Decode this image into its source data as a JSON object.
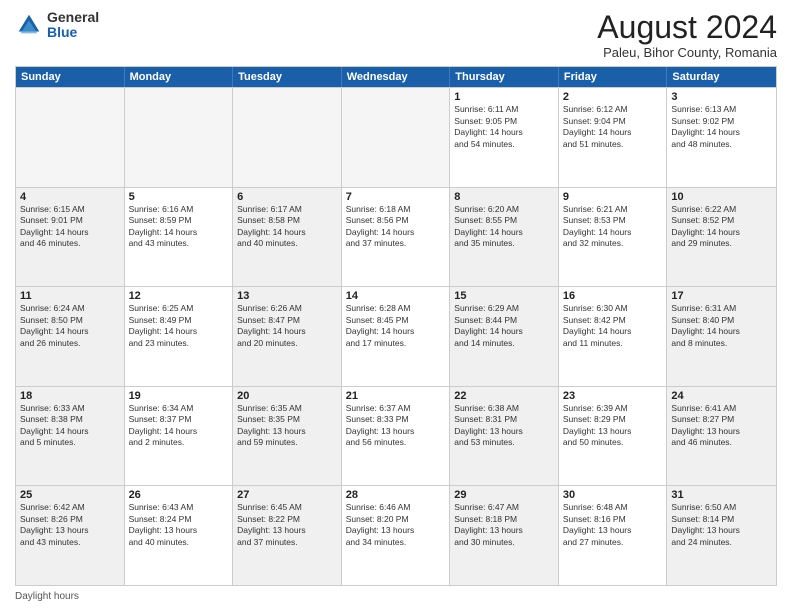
{
  "logo": {
    "general": "General",
    "blue": "Blue"
  },
  "title": "August 2024",
  "location": "Paleu, Bihor County, Romania",
  "days_of_week": [
    "Sunday",
    "Monday",
    "Tuesday",
    "Wednesday",
    "Thursday",
    "Friday",
    "Saturday"
  ],
  "footer_note": "Daylight hours",
  "weeks": [
    [
      {
        "day": "",
        "info": "",
        "empty": true
      },
      {
        "day": "",
        "info": "",
        "empty": true
      },
      {
        "day": "",
        "info": "",
        "empty": true
      },
      {
        "day": "",
        "info": "",
        "empty": true
      },
      {
        "day": "1",
        "info": "Sunrise: 6:11 AM\nSunset: 9:05 PM\nDaylight: 14 hours\nand 54 minutes."
      },
      {
        "day": "2",
        "info": "Sunrise: 6:12 AM\nSunset: 9:04 PM\nDaylight: 14 hours\nand 51 minutes."
      },
      {
        "day": "3",
        "info": "Sunrise: 6:13 AM\nSunset: 9:02 PM\nDaylight: 14 hours\nand 48 minutes."
      }
    ],
    [
      {
        "day": "4",
        "info": "Sunrise: 6:15 AM\nSunset: 9:01 PM\nDaylight: 14 hours\nand 46 minutes.",
        "shaded": true
      },
      {
        "day": "5",
        "info": "Sunrise: 6:16 AM\nSunset: 8:59 PM\nDaylight: 14 hours\nand 43 minutes."
      },
      {
        "day": "6",
        "info": "Sunrise: 6:17 AM\nSunset: 8:58 PM\nDaylight: 14 hours\nand 40 minutes.",
        "shaded": true
      },
      {
        "day": "7",
        "info": "Sunrise: 6:18 AM\nSunset: 8:56 PM\nDaylight: 14 hours\nand 37 minutes."
      },
      {
        "day": "8",
        "info": "Sunrise: 6:20 AM\nSunset: 8:55 PM\nDaylight: 14 hours\nand 35 minutes.",
        "shaded": true
      },
      {
        "day": "9",
        "info": "Sunrise: 6:21 AM\nSunset: 8:53 PM\nDaylight: 14 hours\nand 32 minutes."
      },
      {
        "day": "10",
        "info": "Sunrise: 6:22 AM\nSunset: 8:52 PM\nDaylight: 14 hours\nand 29 minutes.",
        "shaded": true
      }
    ],
    [
      {
        "day": "11",
        "info": "Sunrise: 6:24 AM\nSunset: 8:50 PM\nDaylight: 14 hours\nand 26 minutes.",
        "shaded": true
      },
      {
        "day": "12",
        "info": "Sunrise: 6:25 AM\nSunset: 8:49 PM\nDaylight: 14 hours\nand 23 minutes."
      },
      {
        "day": "13",
        "info": "Sunrise: 6:26 AM\nSunset: 8:47 PM\nDaylight: 14 hours\nand 20 minutes.",
        "shaded": true
      },
      {
        "day": "14",
        "info": "Sunrise: 6:28 AM\nSunset: 8:45 PM\nDaylight: 14 hours\nand 17 minutes."
      },
      {
        "day": "15",
        "info": "Sunrise: 6:29 AM\nSunset: 8:44 PM\nDaylight: 14 hours\nand 14 minutes.",
        "shaded": true
      },
      {
        "day": "16",
        "info": "Sunrise: 6:30 AM\nSunset: 8:42 PM\nDaylight: 14 hours\nand 11 minutes."
      },
      {
        "day": "17",
        "info": "Sunrise: 6:31 AM\nSunset: 8:40 PM\nDaylight: 14 hours\nand 8 minutes.",
        "shaded": true
      }
    ],
    [
      {
        "day": "18",
        "info": "Sunrise: 6:33 AM\nSunset: 8:38 PM\nDaylight: 14 hours\nand 5 minutes.",
        "shaded": true
      },
      {
        "day": "19",
        "info": "Sunrise: 6:34 AM\nSunset: 8:37 PM\nDaylight: 14 hours\nand 2 minutes."
      },
      {
        "day": "20",
        "info": "Sunrise: 6:35 AM\nSunset: 8:35 PM\nDaylight: 13 hours\nand 59 minutes.",
        "shaded": true
      },
      {
        "day": "21",
        "info": "Sunrise: 6:37 AM\nSunset: 8:33 PM\nDaylight: 13 hours\nand 56 minutes."
      },
      {
        "day": "22",
        "info": "Sunrise: 6:38 AM\nSunset: 8:31 PM\nDaylight: 13 hours\nand 53 minutes.",
        "shaded": true
      },
      {
        "day": "23",
        "info": "Sunrise: 6:39 AM\nSunset: 8:29 PM\nDaylight: 13 hours\nand 50 minutes."
      },
      {
        "day": "24",
        "info": "Sunrise: 6:41 AM\nSunset: 8:27 PM\nDaylight: 13 hours\nand 46 minutes.",
        "shaded": true
      }
    ],
    [
      {
        "day": "25",
        "info": "Sunrise: 6:42 AM\nSunset: 8:26 PM\nDaylight: 13 hours\nand 43 minutes.",
        "shaded": true
      },
      {
        "day": "26",
        "info": "Sunrise: 6:43 AM\nSunset: 8:24 PM\nDaylight: 13 hours\nand 40 minutes."
      },
      {
        "day": "27",
        "info": "Sunrise: 6:45 AM\nSunset: 8:22 PM\nDaylight: 13 hours\nand 37 minutes.",
        "shaded": true
      },
      {
        "day": "28",
        "info": "Sunrise: 6:46 AM\nSunset: 8:20 PM\nDaylight: 13 hours\nand 34 minutes."
      },
      {
        "day": "29",
        "info": "Sunrise: 6:47 AM\nSunset: 8:18 PM\nDaylight: 13 hours\nand 30 minutes.",
        "shaded": true
      },
      {
        "day": "30",
        "info": "Sunrise: 6:48 AM\nSunset: 8:16 PM\nDaylight: 13 hours\nand 27 minutes."
      },
      {
        "day": "31",
        "info": "Sunrise: 6:50 AM\nSunset: 8:14 PM\nDaylight: 13 hours\nand 24 minutes.",
        "shaded": true
      }
    ]
  ]
}
